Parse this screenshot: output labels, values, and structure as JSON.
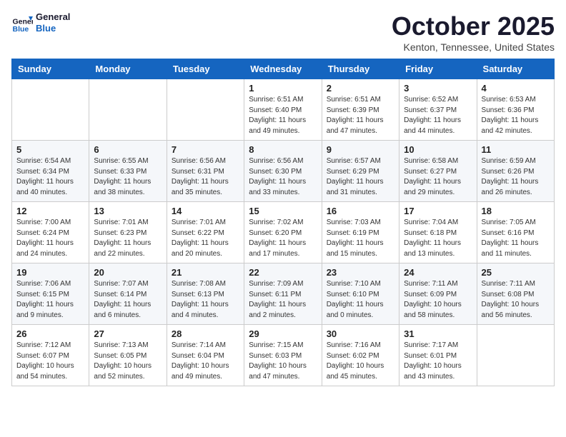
{
  "logo": {
    "line1": "General",
    "line2": "Blue"
  },
  "title": "October 2025",
  "location": "Kenton, Tennessee, United States",
  "days_of_week": [
    "Sunday",
    "Monday",
    "Tuesday",
    "Wednesday",
    "Thursday",
    "Friday",
    "Saturday"
  ],
  "weeks": [
    [
      {
        "day": "",
        "info": ""
      },
      {
        "day": "",
        "info": ""
      },
      {
        "day": "",
        "info": ""
      },
      {
        "day": "1",
        "info": "Sunrise: 6:51 AM\nSunset: 6:40 PM\nDaylight: 11 hours and 49 minutes."
      },
      {
        "day": "2",
        "info": "Sunrise: 6:51 AM\nSunset: 6:39 PM\nDaylight: 11 hours and 47 minutes."
      },
      {
        "day": "3",
        "info": "Sunrise: 6:52 AM\nSunset: 6:37 PM\nDaylight: 11 hours and 44 minutes."
      },
      {
        "day": "4",
        "info": "Sunrise: 6:53 AM\nSunset: 6:36 PM\nDaylight: 11 hours and 42 minutes."
      }
    ],
    [
      {
        "day": "5",
        "info": "Sunrise: 6:54 AM\nSunset: 6:34 PM\nDaylight: 11 hours and 40 minutes."
      },
      {
        "day": "6",
        "info": "Sunrise: 6:55 AM\nSunset: 6:33 PM\nDaylight: 11 hours and 38 minutes."
      },
      {
        "day": "7",
        "info": "Sunrise: 6:56 AM\nSunset: 6:31 PM\nDaylight: 11 hours and 35 minutes."
      },
      {
        "day": "8",
        "info": "Sunrise: 6:56 AM\nSunset: 6:30 PM\nDaylight: 11 hours and 33 minutes."
      },
      {
        "day": "9",
        "info": "Sunrise: 6:57 AM\nSunset: 6:29 PM\nDaylight: 11 hours and 31 minutes."
      },
      {
        "day": "10",
        "info": "Sunrise: 6:58 AM\nSunset: 6:27 PM\nDaylight: 11 hours and 29 minutes."
      },
      {
        "day": "11",
        "info": "Sunrise: 6:59 AM\nSunset: 6:26 PM\nDaylight: 11 hours and 26 minutes."
      }
    ],
    [
      {
        "day": "12",
        "info": "Sunrise: 7:00 AM\nSunset: 6:24 PM\nDaylight: 11 hours and 24 minutes."
      },
      {
        "day": "13",
        "info": "Sunrise: 7:01 AM\nSunset: 6:23 PM\nDaylight: 11 hours and 22 minutes."
      },
      {
        "day": "14",
        "info": "Sunrise: 7:01 AM\nSunset: 6:22 PM\nDaylight: 11 hours and 20 minutes."
      },
      {
        "day": "15",
        "info": "Sunrise: 7:02 AM\nSunset: 6:20 PM\nDaylight: 11 hours and 17 minutes."
      },
      {
        "day": "16",
        "info": "Sunrise: 7:03 AM\nSunset: 6:19 PM\nDaylight: 11 hours and 15 minutes."
      },
      {
        "day": "17",
        "info": "Sunrise: 7:04 AM\nSunset: 6:18 PM\nDaylight: 11 hours and 13 minutes."
      },
      {
        "day": "18",
        "info": "Sunrise: 7:05 AM\nSunset: 6:16 PM\nDaylight: 11 hours and 11 minutes."
      }
    ],
    [
      {
        "day": "19",
        "info": "Sunrise: 7:06 AM\nSunset: 6:15 PM\nDaylight: 11 hours and 9 minutes."
      },
      {
        "day": "20",
        "info": "Sunrise: 7:07 AM\nSunset: 6:14 PM\nDaylight: 11 hours and 6 minutes."
      },
      {
        "day": "21",
        "info": "Sunrise: 7:08 AM\nSunset: 6:13 PM\nDaylight: 11 hours and 4 minutes."
      },
      {
        "day": "22",
        "info": "Sunrise: 7:09 AM\nSunset: 6:11 PM\nDaylight: 11 hours and 2 minutes."
      },
      {
        "day": "23",
        "info": "Sunrise: 7:10 AM\nSunset: 6:10 PM\nDaylight: 11 hours and 0 minutes."
      },
      {
        "day": "24",
        "info": "Sunrise: 7:11 AM\nSunset: 6:09 PM\nDaylight: 10 hours and 58 minutes."
      },
      {
        "day": "25",
        "info": "Sunrise: 7:11 AM\nSunset: 6:08 PM\nDaylight: 10 hours and 56 minutes."
      }
    ],
    [
      {
        "day": "26",
        "info": "Sunrise: 7:12 AM\nSunset: 6:07 PM\nDaylight: 10 hours and 54 minutes."
      },
      {
        "day": "27",
        "info": "Sunrise: 7:13 AM\nSunset: 6:05 PM\nDaylight: 10 hours and 52 minutes."
      },
      {
        "day": "28",
        "info": "Sunrise: 7:14 AM\nSunset: 6:04 PM\nDaylight: 10 hours and 49 minutes."
      },
      {
        "day": "29",
        "info": "Sunrise: 7:15 AM\nSunset: 6:03 PM\nDaylight: 10 hours and 47 minutes."
      },
      {
        "day": "30",
        "info": "Sunrise: 7:16 AM\nSunset: 6:02 PM\nDaylight: 10 hours and 45 minutes."
      },
      {
        "day": "31",
        "info": "Sunrise: 7:17 AM\nSunset: 6:01 PM\nDaylight: 10 hours and 43 minutes."
      },
      {
        "day": "",
        "info": ""
      }
    ]
  ]
}
